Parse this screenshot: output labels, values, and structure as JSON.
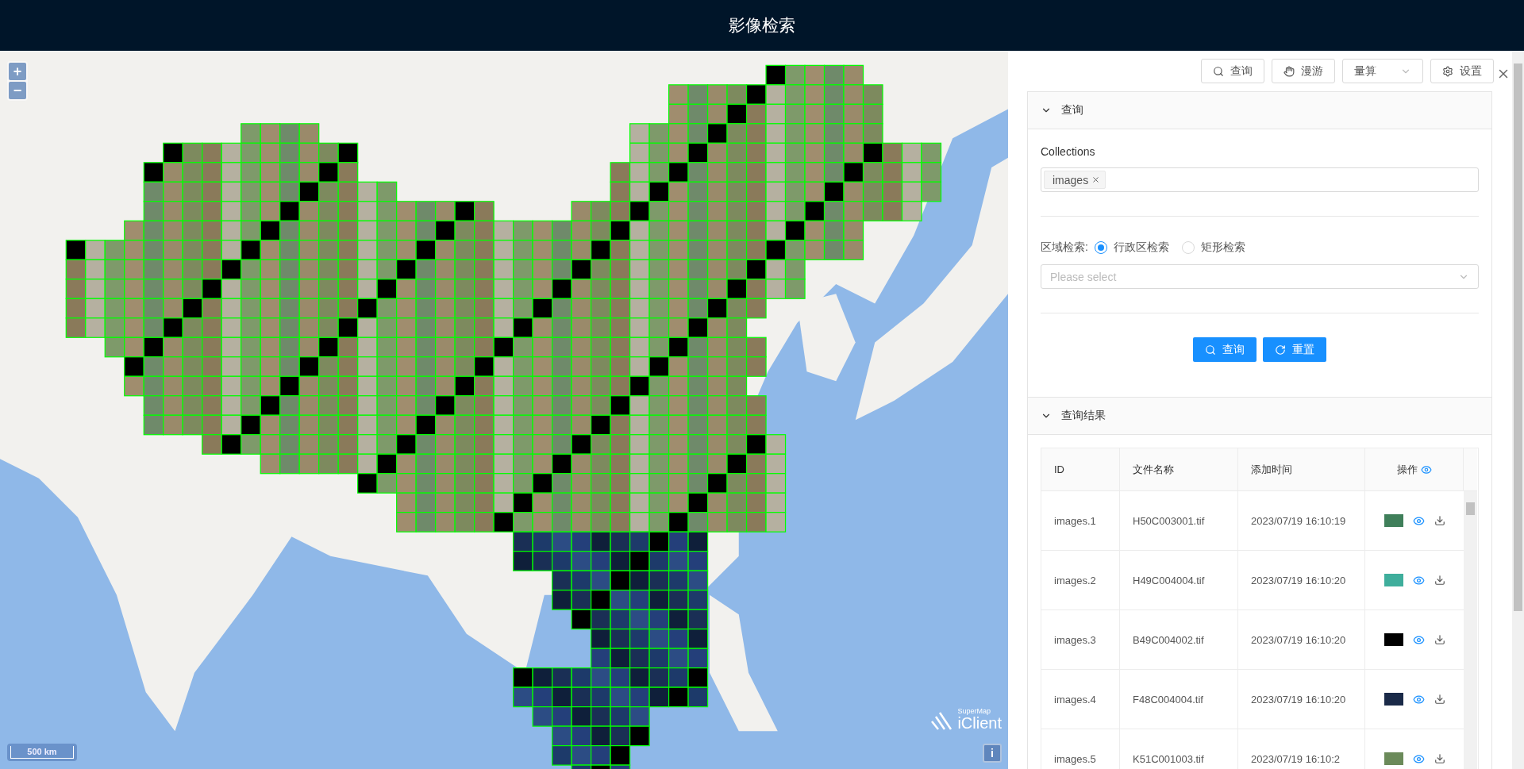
{
  "header": {
    "title": "影像检索"
  },
  "map": {
    "zoom_in": "+",
    "zoom_out": "−",
    "scale": "500 km",
    "logo_brand": "SuperMap",
    "logo_product": "iClient",
    "info": "i"
  },
  "toolbar": [
    {
      "kind": "button",
      "label": "查询"
    },
    {
      "kind": "button",
      "label": "漫游"
    },
    {
      "kind": "select",
      "label": "量算"
    },
    {
      "kind": "button",
      "label": "设置"
    }
  ],
  "query_panel": {
    "title": "查询",
    "expanded": true,
    "collections_label": "Collections",
    "tags": [
      "images"
    ],
    "region_label": "区域检索:",
    "radios": [
      {
        "label": "行政区检索",
        "selected": true
      },
      {
        "label": "矩形检索",
        "selected": false
      }
    ],
    "select_placeholder": "Please select",
    "buttons": [
      "查询",
      "重置"
    ]
  },
  "results_panel": {
    "title": "查询结果",
    "expanded": true,
    "table": {
      "columns": [
        "ID",
        "文件名称",
        "添加时间",
        "操作"
      ],
      "rows": [
        {
          "id": "images.1",
          "file": "H50C003001.tif",
          "time": "2023/07/19 16:10:19",
          "color": "#3f7f5a"
        },
        {
          "id": "images.2",
          "file": "H49C004004.tif",
          "time": "2023/07/19 16:10:20",
          "color": "#3fae9c"
        },
        {
          "id": "images.3",
          "file": "B49C004002.tif",
          "time": "2023/07/19 16:10:20",
          "color": "#000000"
        },
        {
          "id": "images.4",
          "file": "F48C004004.tif",
          "time": "2023/07/19 16:10:20",
          "color": "#1a2a48"
        },
        {
          "id": "images.5",
          "file": "K51C001003.tif",
          "time": "2023/07/19 16:10:2",
          "color": "#6b8a5a"
        }
      ]
    }
  }
}
